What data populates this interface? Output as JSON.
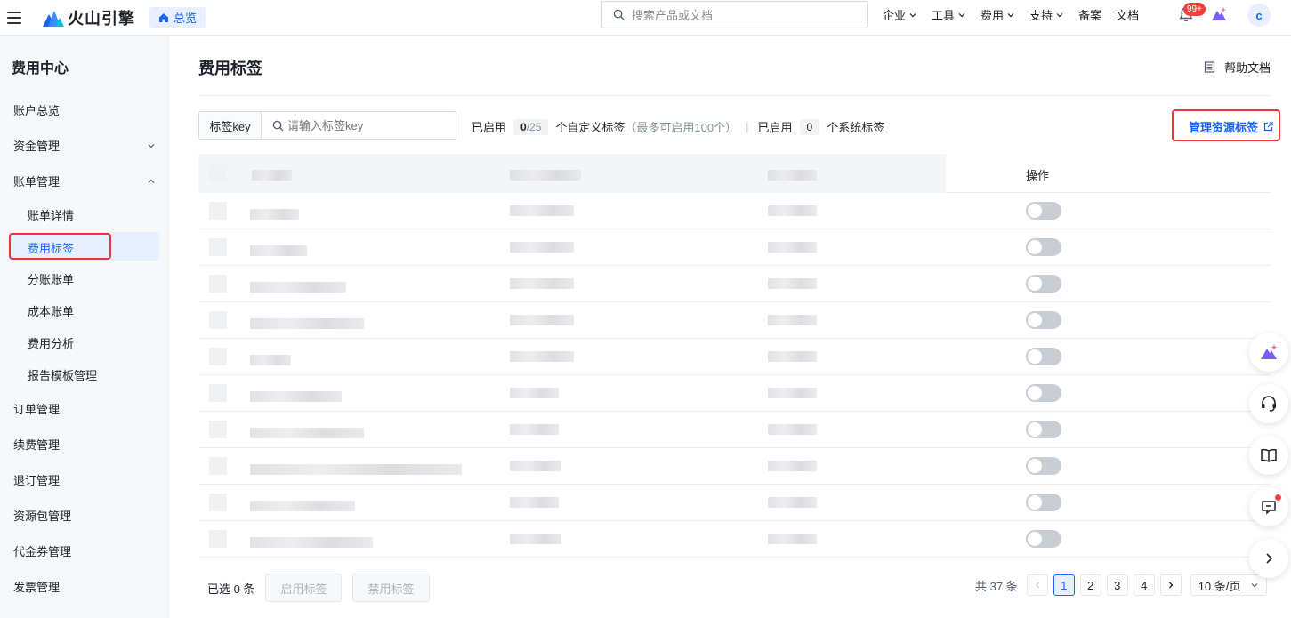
{
  "topbar": {
    "brand": "火山引擎",
    "home_chip": "总览",
    "search_placeholder": "搜索产品或文档",
    "nav": [
      {
        "label": "企业",
        "has_menu": true
      },
      {
        "label": "工具",
        "has_menu": true
      },
      {
        "label": "费用",
        "has_menu": true
      },
      {
        "label": "支持",
        "has_menu": true
      },
      {
        "label": "备案",
        "has_menu": false
      },
      {
        "label": "文档",
        "has_menu": false
      }
    ],
    "notification_badge": "99+",
    "avatar_initial": "c"
  },
  "sidebar": {
    "title": "费用中心",
    "items": [
      {
        "label": "账户总览"
      },
      {
        "label": "资金管理",
        "expanded": false
      },
      {
        "label": "账单管理",
        "expanded": true
      },
      {
        "label": "账单详情"
      },
      {
        "label": "费用标签",
        "active": true
      },
      {
        "label": "分账账单"
      },
      {
        "label": "成本账单"
      },
      {
        "label": "费用分析"
      },
      {
        "label": "报告模板管理"
      },
      {
        "label": "订单管理"
      },
      {
        "label": "续费管理"
      },
      {
        "label": "退订管理"
      },
      {
        "label": "资源包管理"
      },
      {
        "label": "代金券管理"
      },
      {
        "label": "发票管理"
      }
    ]
  },
  "main": {
    "title": "费用标签",
    "help_label": "帮助文档",
    "filter_key_label": "标签key",
    "filter_placeholder": "请输入标签key",
    "status": {
      "enabled_prefix": "已启用",
      "custom_count": "0",
      "custom_total": "/25",
      "custom_suffix": "个自定义标签",
      "custom_note": "（最多可启用100个）",
      "separator": "|",
      "system_prefix": "已启用",
      "system_count": "0",
      "system_suffix": "个系统标签"
    },
    "manage_link": "管理资源标签",
    "table": {
      "op_header": "操作",
      "rows": [
        {
          "enabled": false
        },
        {
          "enabled": false
        },
        {
          "enabled": false
        },
        {
          "enabled": false
        },
        {
          "enabled": false
        },
        {
          "enabled": false
        },
        {
          "enabled": false
        },
        {
          "enabled": false
        },
        {
          "enabled": false
        },
        {
          "enabled": false
        }
      ]
    },
    "footer": {
      "selected": "已选 0 条",
      "enable_btn": "启用标签",
      "disable_btn": "禁用标签",
      "total": "共 37 条",
      "pages": [
        "1",
        "2",
        "3",
        "4"
      ],
      "current_page": "1",
      "page_size": "10 条/页"
    }
  },
  "colors": {
    "accent": "#1664ff",
    "highlight_box": "#e5383b",
    "badge": "#f53f3f"
  }
}
